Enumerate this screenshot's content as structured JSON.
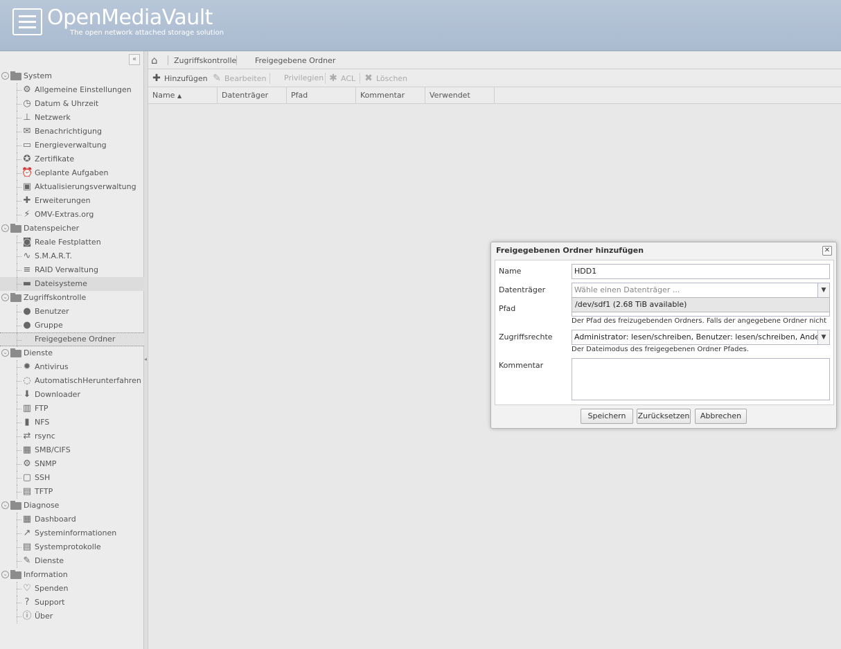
{
  "header": {
    "logo_title": "OpenMediaVault",
    "logo_subtitle": "The open network attached storage solution"
  },
  "sidebar": {
    "collapse_icon": "double-chevron-left-icon",
    "groups": [
      {
        "label": "System",
        "items": [
          {
            "label": "Allgemeine Einstellungen",
            "icon": "gears-icon"
          },
          {
            "label": "Datum & Uhrzeit",
            "icon": "clock-icon"
          },
          {
            "label": "Netzwerk",
            "icon": "network-icon"
          },
          {
            "label": "Benachrichtigung",
            "icon": "envelope-icon"
          },
          {
            "label": "Energieverwaltung",
            "icon": "battery-icon"
          },
          {
            "label": "Zertifikate",
            "icon": "certificate-icon"
          },
          {
            "label": "Geplante Aufgaben",
            "icon": "alarm-clock-icon"
          },
          {
            "label": "Aktualisierungsverwaltung",
            "icon": "update-icon"
          },
          {
            "label": "Erweiterungen",
            "icon": "puzzle-icon"
          },
          {
            "label": "OMV-Extras.org",
            "icon": "plug-icon"
          }
        ]
      },
      {
        "label": "Datenspeicher",
        "items": [
          {
            "label": "Reale Festplatten",
            "icon": "disk-icon"
          },
          {
            "label": "S.M.A.R.T.",
            "icon": "heartbeat-icon"
          },
          {
            "label": "RAID Verwaltung",
            "icon": "database-icon"
          },
          {
            "label": "Dateisysteme",
            "icon": "folder-icon"
          }
        ]
      },
      {
        "label": "Zugriffskontrolle",
        "items": [
          {
            "label": "Benutzer",
            "icon": "user-icon"
          },
          {
            "label": "Gruppe",
            "icon": "users-icon"
          },
          {
            "label": "Freigegebene Ordner",
            "icon": "shared-folder-icon"
          }
        ]
      },
      {
        "label": "Dienste",
        "items": [
          {
            "label": "Antivirus",
            "icon": "virus-icon"
          },
          {
            "label": "AutomatischHerunterfahren",
            "icon": "power-icon"
          },
          {
            "label": "Downloader",
            "icon": "download-icon"
          },
          {
            "label": "FTP",
            "icon": "ftp-icon"
          },
          {
            "label": "NFS",
            "icon": "file-icon"
          },
          {
            "label": "rsync",
            "icon": "sync-icon"
          },
          {
            "label": "SMB/CIFS",
            "icon": "windows-icon"
          },
          {
            "label": "SNMP",
            "icon": "snmp-icon"
          },
          {
            "label": "SSH",
            "icon": "terminal-icon"
          },
          {
            "label": "TFTP",
            "icon": "tftp-icon"
          }
        ]
      },
      {
        "label": "Diagnose",
        "items": [
          {
            "label": "Dashboard",
            "icon": "grid-icon"
          },
          {
            "label": "Systeminformationen",
            "icon": "chart-icon"
          },
          {
            "label": "Systemprotokolle",
            "icon": "log-icon"
          },
          {
            "label": "Dienste",
            "icon": "wrench-icon"
          }
        ]
      },
      {
        "label": "Information",
        "items": [
          {
            "label": "Spenden",
            "icon": "heart-icon"
          },
          {
            "label": "Support",
            "icon": "question-icon"
          },
          {
            "label": "Über",
            "icon": "info-icon"
          }
        ]
      }
    ]
  },
  "breadcrumb": {
    "home_icon": "home-icon",
    "items": [
      "Zugriffskontrolle",
      "Freigegebene Ordner"
    ]
  },
  "toolbar": {
    "add": "Hinzufügen",
    "edit": "Bearbeiten",
    "privileges": "Privilegien",
    "acl": "ACL",
    "delete": "Löschen"
  },
  "grid": {
    "columns": [
      "Name",
      "Datenträger",
      "Pfad",
      "Kommentar",
      "Verwendet"
    ]
  },
  "dialog": {
    "title": "Freigegebenen Ordner hinzufügen",
    "labels": {
      "name": "Name",
      "device": "Datenträger",
      "path": "Pfad",
      "permissions": "Zugriffsrechte",
      "comment": "Kommentar"
    },
    "name_value": "HDD1",
    "device_placeholder": "Wähle einen Datenträger ...",
    "device_option": "/dev/sdf1 (2.68 TiB available)",
    "path_hint": "Der Pfad des freizugebenden Ordners. Falls der angegebene Ordner nicht",
    "permissions_value": "Administrator: lesen/schreiben, Benutzer: lesen/schreiben, Andere: nur lesen",
    "permissions_hint": "Der Dateimodus des freigegebenen Ordner Pfades.",
    "buttons": {
      "save": "Speichern",
      "reset": "Zurücksetzen",
      "cancel": "Abbrechen"
    }
  }
}
